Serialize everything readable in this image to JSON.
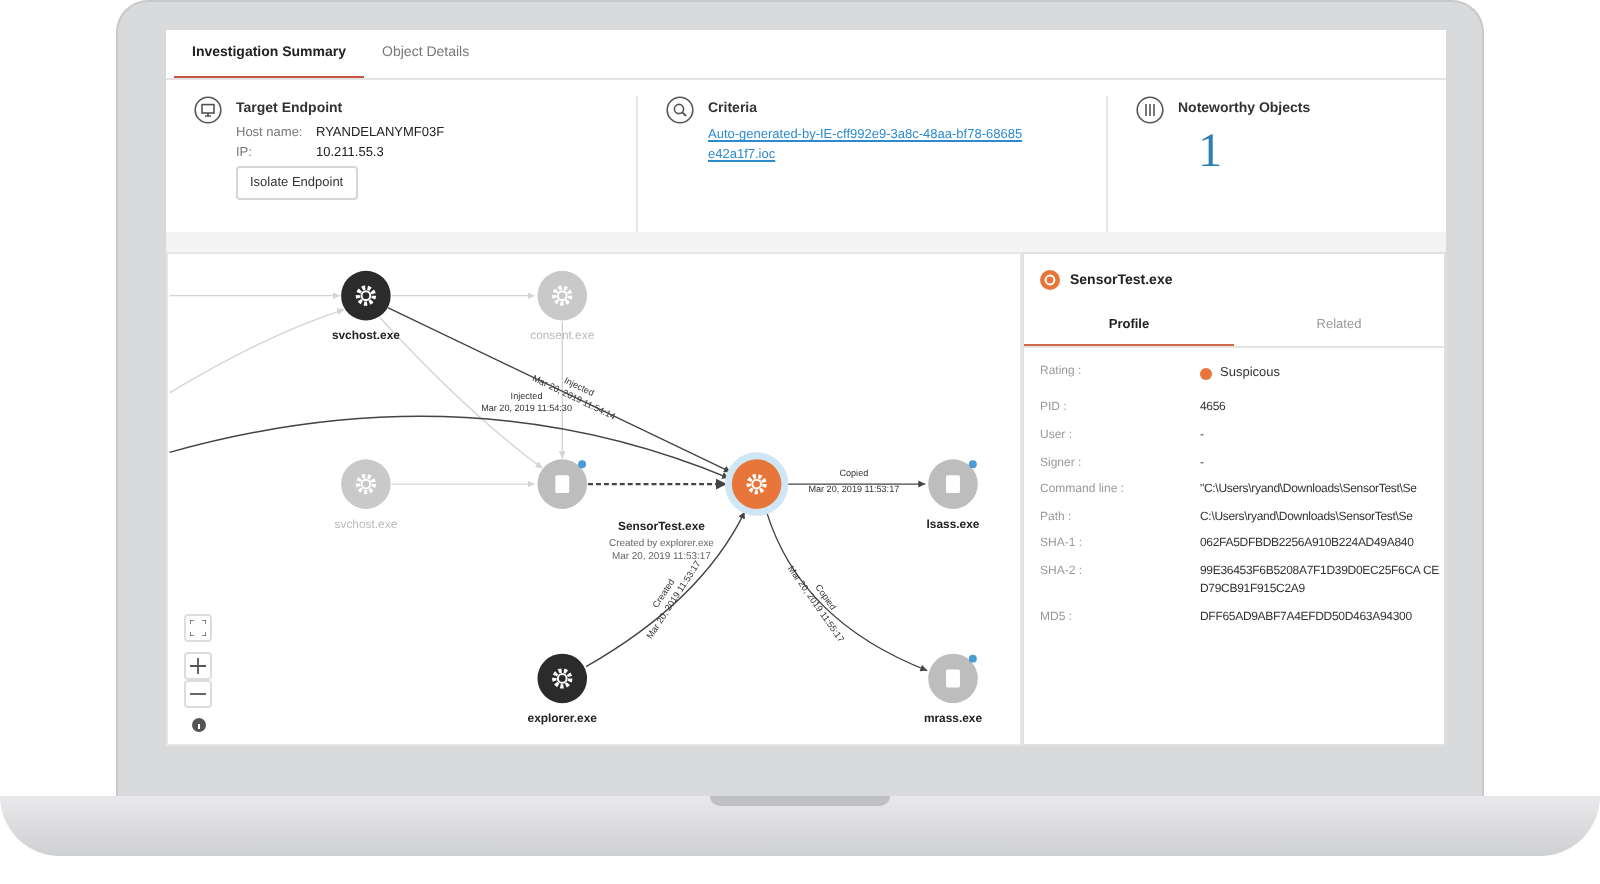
{
  "tabs": [
    {
      "label": "Investigation Summary",
      "selected": true
    },
    {
      "label": "Object Details",
      "selected": false
    }
  ],
  "summary": {
    "endpoint": {
      "title": "Target Endpoint",
      "fields": [
        {
          "label": "Host name:",
          "value": "RYANDELANYMF03F"
        },
        {
          "label": "IP:",
          "value": "10.211.55.3"
        }
      ],
      "button": "Isolate Endpoint"
    },
    "criteria": {
      "title": "Criteria",
      "link": "Auto-generated-by-IE-cff992e9-3a8c-48aa-bf78-68685e42a1f7.ioc"
    },
    "noteworthy": {
      "title": "Noteworthy Objects",
      "count": "1"
    }
  },
  "graph": {
    "nodes": [
      {
        "kind": "process",
        "label": "svchost.exe",
        "faded": false,
        "selected": false,
        "flagged": false
      },
      {
        "kind": "process",
        "label": "consent.exe",
        "faded": true,
        "selected": false,
        "flagged": false
      },
      {
        "kind": "process",
        "label": "svchost.exe",
        "faded": true,
        "selected": false,
        "flagged": false
      },
      {
        "kind": "file",
        "faded": false,
        "selected": false,
        "flagged": true
      },
      {
        "kind": "process",
        "label": "SensorTest.exe",
        "detail": "Created by explorer.exe",
        "time": "Mar 20, 2019 11:53:17",
        "faded": false,
        "selected": true,
        "flagged": false
      },
      {
        "kind": "file",
        "label": "lsass.exe",
        "faded": false,
        "selected": false,
        "flagged": true
      },
      {
        "kind": "process",
        "label": "explorer.exe",
        "faded": false,
        "selected": false,
        "flagged": false
      },
      {
        "kind": "file",
        "label": "mrass.exe",
        "faded": false,
        "selected": false,
        "flagged": true
      }
    ],
    "edges": [
      {
        "label": "Injected",
        "time": "Mar 20, 2019 11:54:14"
      },
      {
        "label": "Injected",
        "time": "Mar 20, 2019 11:54:30"
      },
      {
        "label": "Copied",
        "time": "Mar 20, 2019 11:53:17"
      },
      {
        "label": "Created",
        "time": "Mar 20, 2019 11:53:17"
      },
      {
        "label": "Copied",
        "time": "Mar 20, 2019 11:55:17"
      }
    ]
  },
  "details": {
    "title": "SensorTest.exe",
    "tabs": [
      {
        "label": "Profile",
        "selected": true
      },
      {
        "label": "Related",
        "selected": false
      }
    ],
    "rating": {
      "label": "Rating :",
      "value": "Suspicous",
      "color": "#e8763a"
    },
    "rows": [
      {
        "label": "PID :",
        "value": "4656"
      },
      {
        "label": "User :",
        "value": "-"
      },
      {
        "label": "Signer :",
        "value": "-"
      },
      {
        "label": "Command line :",
        "value": "\"C:\\Users\\ryand\\Downloads\\SensorTest\\Se"
      },
      {
        "label": "Path :",
        "value": "C:\\Users\\ryand\\Downloads\\SensorTest\\Se"
      },
      {
        "label": "SHA-1 :",
        "value": "062FA5DFBDB2256A910B224AD49A840"
      },
      {
        "label": "SHA-2 :",
        "value": "99E36453F6B5208A7F1D39D0EC25F6CA CED79CB91F915C2A9"
      },
      {
        "label": "MD5 :",
        "value": "DFF65AD9ABF7A4EFDD50D463A94300"
      }
    ]
  }
}
